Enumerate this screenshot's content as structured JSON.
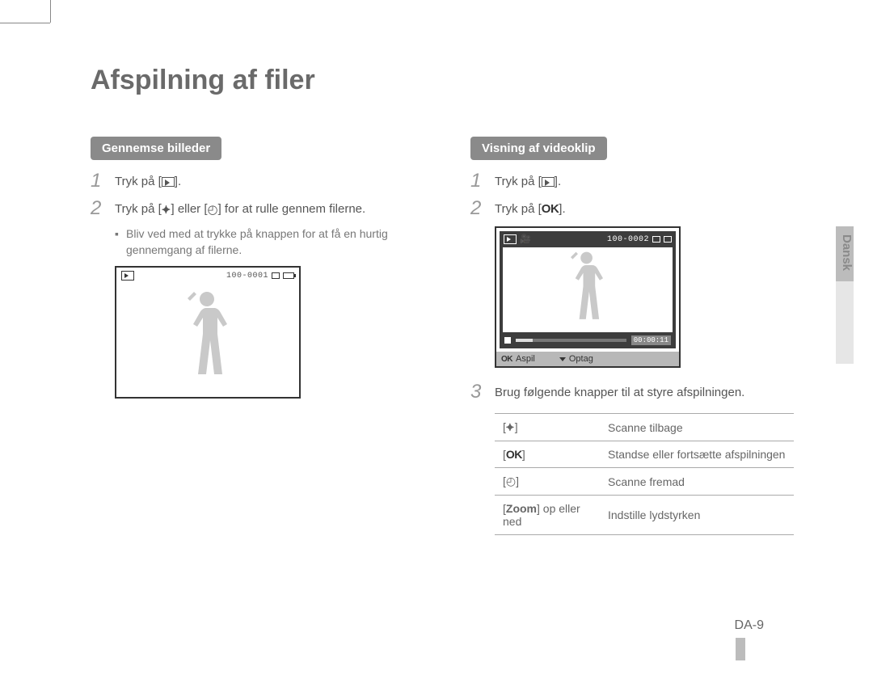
{
  "title": "Afspilning af filer",
  "left": {
    "heading": "Gennemse billeder",
    "step1_pre": "Tryk på [",
    "step1_post": "].",
    "step2_pre": "Tryk på [",
    "step2_mid1": "] eller [",
    "step2_mid2": "] for at rulle gennem filerne.",
    "sub": "Bliv ved med at trykke på knappen for at få en hurtig gennemgang af filerne.",
    "screen_counter": "100-0001"
  },
  "right": {
    "heading": "Visning af videoklip",
    "step1_pre": "Tryk på [",
    "step1_post": "].",
    "step2_pre": "Tryk på [",
    "step2_post": "].",
    "screen_counter": "100-0002",
    "screen_time": "00:00:11",
    "footer_ok": "OK",
    "footer_play": "Aspil",
    "footer_record": "Optag",
    "step3": "Brug følgende knapper til at styre afspilningen.",
    "table": {
      "r1_desc": "Scanne tilbage",
      "r2_desc": "Standse eller fortsætte afspilningen",
      "r3_desc": "Scanne fremad",
      "r4_key_strong": "Zoom",
      "r4_key_rest": " op eller ned",
      "r4_desc": "Indstille lydstyrken"
    }
  },
  "ok_label": "OK",
  "side_tab": "Dansk",
  "page_number": "DA-9",
  "icons": {
    "flash": "⚡",
    "timer": "⏲"
  }
}
